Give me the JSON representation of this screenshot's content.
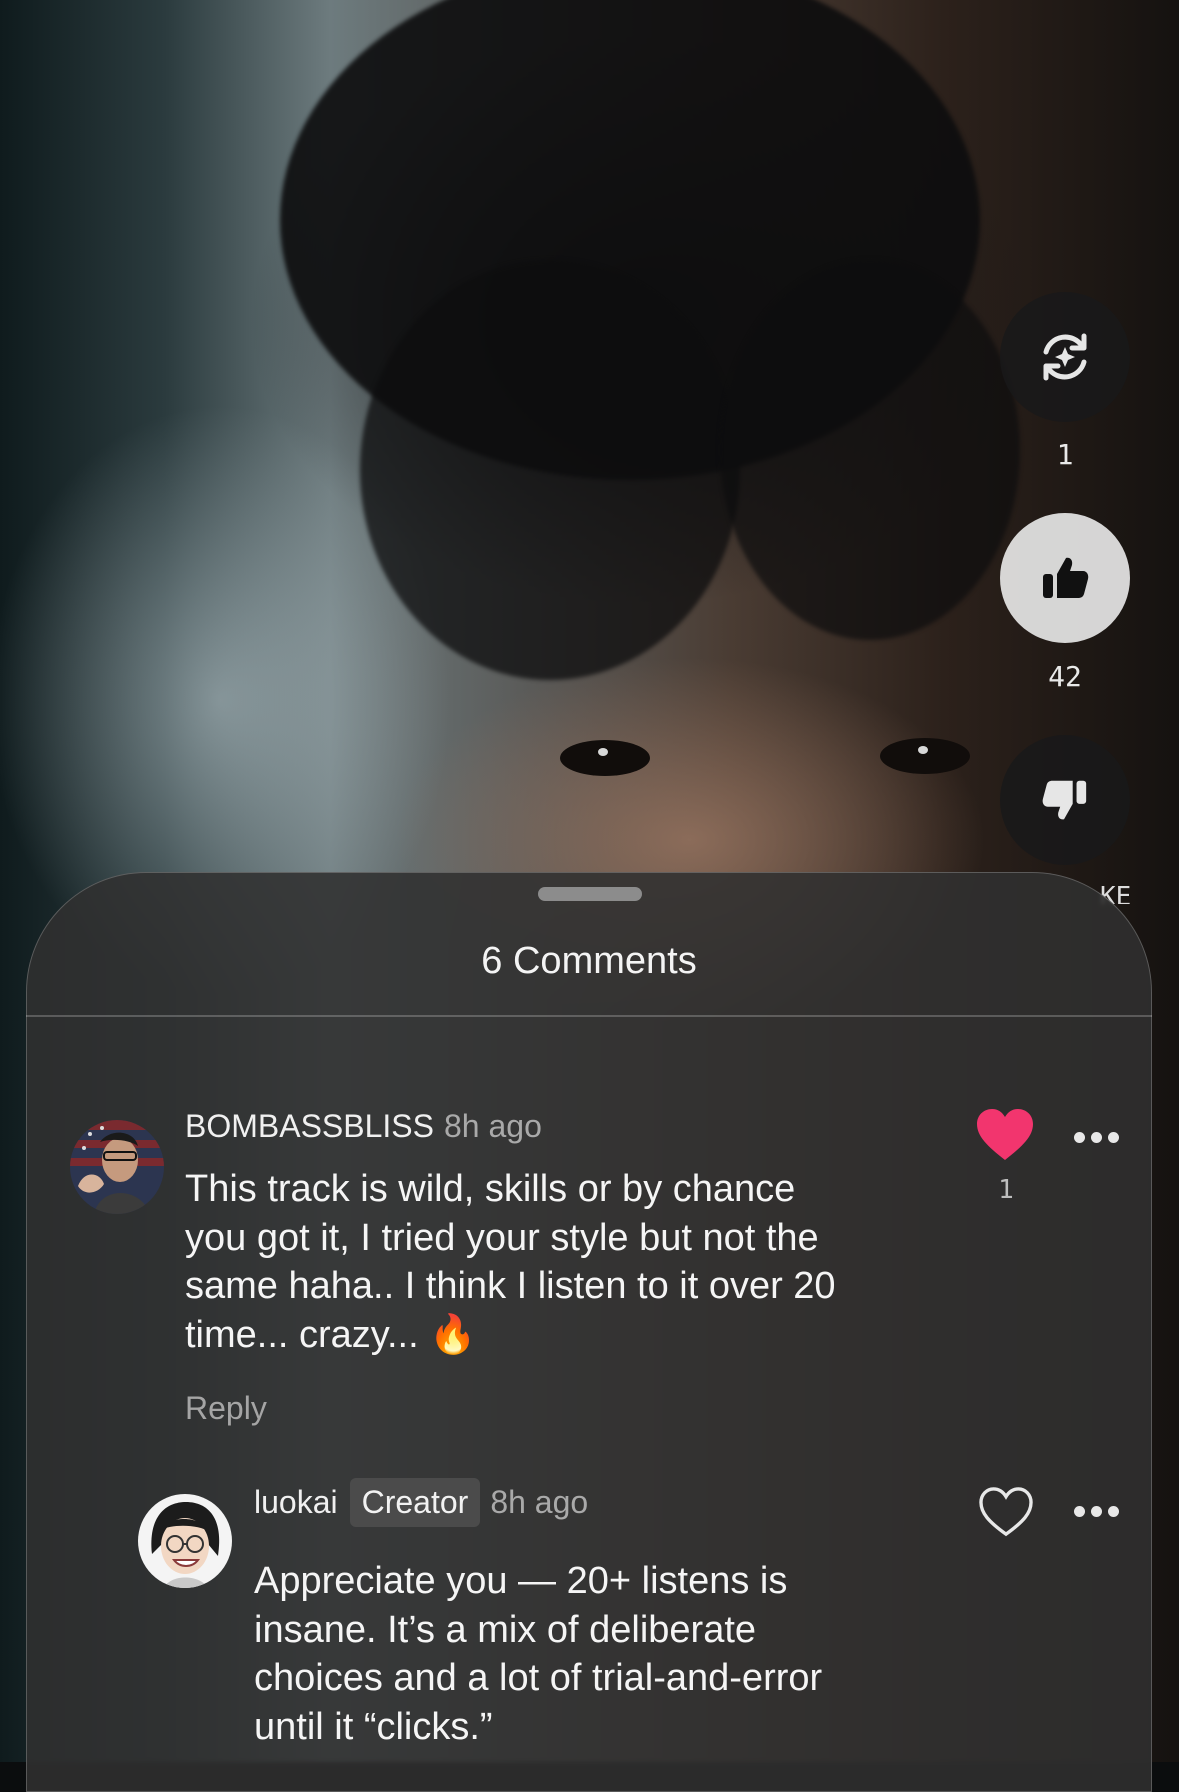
{
  "rail": {
    "remix_count": "1",
    "like_count": "42",
    "cut_label": "KE"
  },
  "comments_sheet": {
    "title": "6 Comments",
    "comments": [
      {
        "username": "BOMBASSBLISS",
        "time": "8h ago",
        "text_lines": [
          "This track is wild, skills or by chance",
          "you got it, I tried your style but not the",
          "same haha.. I think I listen to it over 20",
          "time... crazy... 🔥"
        ],
        "like_count": "1",
        "liked": true,
        "reply_label": "Reply"
      },
      {
        "username": "luokai",
        "badge": "Creator",
        "time": "8h ago",
        "text_lines": [
          "Appreciate you — 20+ listens is",
          "insane. It’s a mix of deliberate",
          "choices and a lot of trial-and-error",
          "until it “clicks.”"
        ],
        "liked": false
      }
    ]
  },
  "colors": {
    "liked_heart": "#f2356e",
    "sheet_bg": "#303030",
    "secondary_text": "#a9a9a9"
  }
}
